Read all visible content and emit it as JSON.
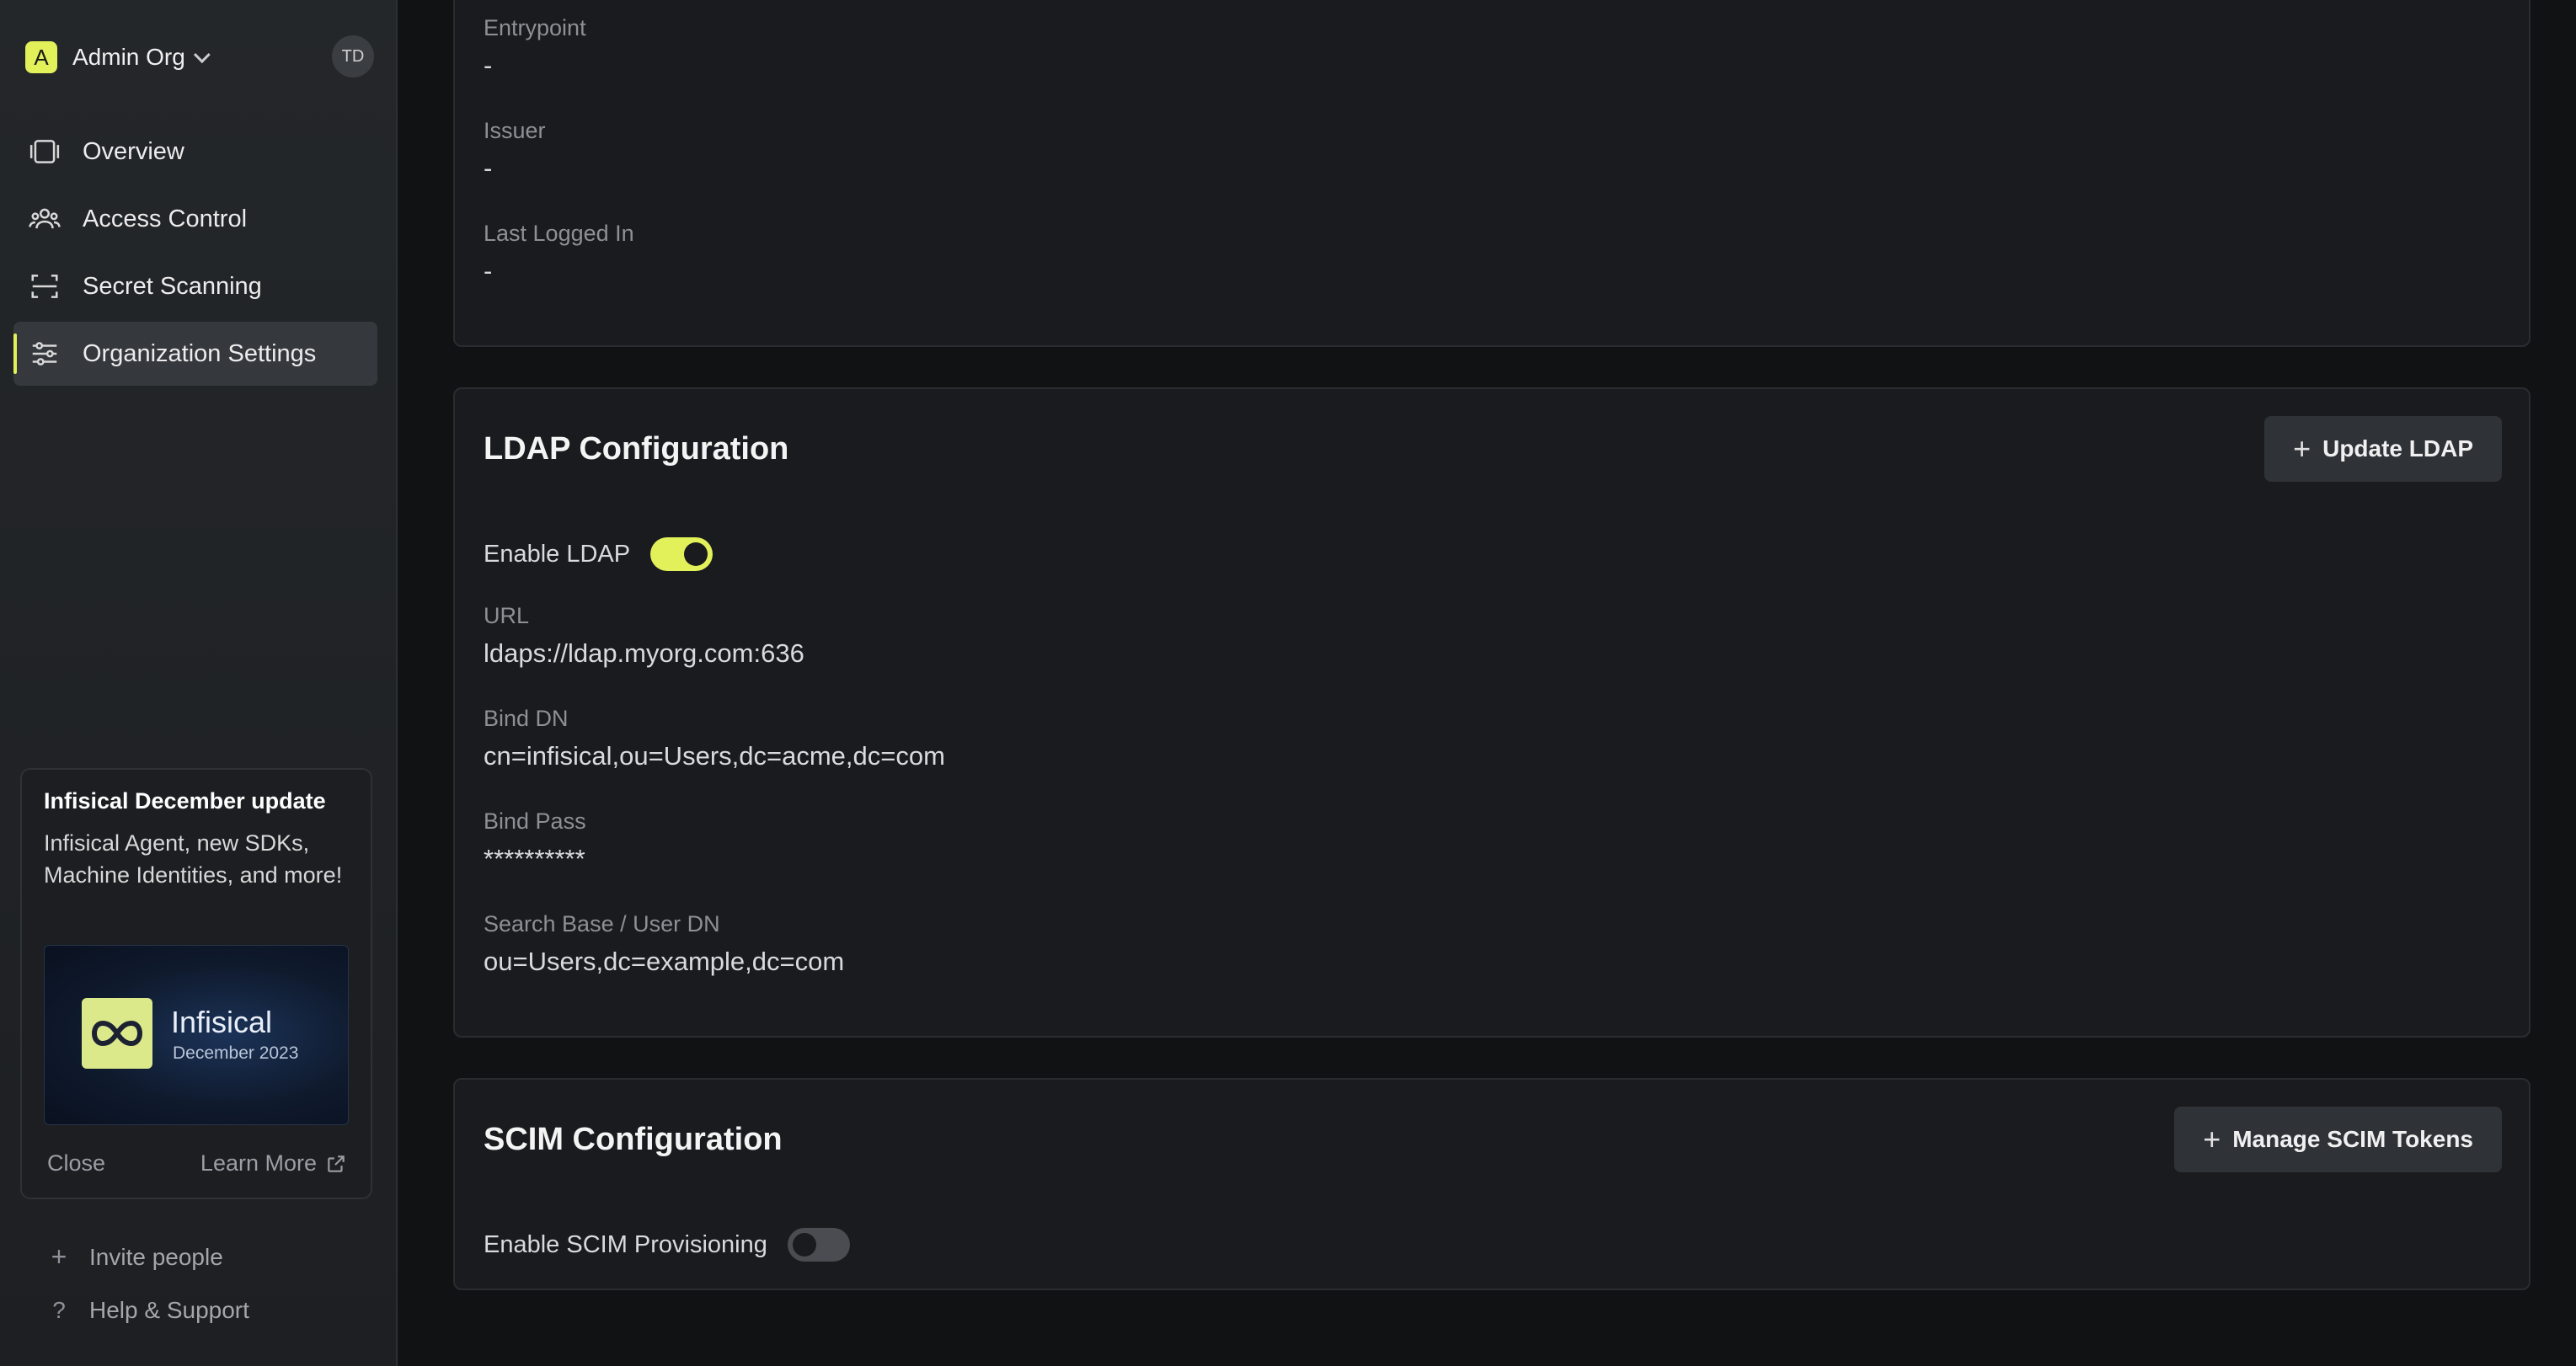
{
  "sidebar": {
    "org": {
      "badge": "A",
      "name": "Admin Org",
      "avatar": "TD"
    },
    "items": [
      {
        "label": "Overview",
        "icon": "overview-icon"
      },
      {
        "label": "Access Control",
        "icon": "users-icon"
      },
      {
        "label": "Secret Scanning",
        "icon": "scan-icon"
      },
      {
        "label": "Organization Settings",
        "icon": "sliders-icon",
        "active": true
      }
    ],
    "promo": {
      "title": "Infisical December update",
      "description": "Infisical Agent, new SDKs, Machine Identities, and more!",
      "image_brand": "Infisical",
      "image_date": "December 2023",
      "close_label": "Close",
      "learn_more_label": "Learn More"
    },
    "invite_label": "Invite people",
    "help_label": "Help & Support"
  },
  "identity_card": {
    "fields": [
      {
        "label": "Entrypoint",
        "value": "-"
      },
      {
        "label": "Issuer",
        "value": "-"
      },
      {
        "label": "Last Logged In",
        "value": "-"
      }
    ]
  },
  "ldap": {
    "title": "LDAP Configuration",
    "button_label": "Update LDAP",
    "toggle_label": "Enable LDAP",
    "toggle_on": true,
    "fields": [
      {
        "label": "URL",
        "value": "ldaps://ldap.myorg.com:636"
      },
      {
        "label": "Bind DN",
        "value": "cn=infisical,ou=Users,dc=acme,dc=com"
      },
      {
        "label": "Bind Pass",
        "value": "**********"
      },
      {
        "label": "Search Base / User DN",
        "value": "ou=Users,dc=example,dc=com"
      }
    ]
  },
  "scim": {
    "title": "SCIM Configuration",
    "button_label": "Manage SCIM Tokens",
    "toggle_label": "Enable SCIM Provisioning",
    "toggle_on": false
  },
  "colors": {
    "accent": "#e2f05a",
    "background": "#111214",
    "card": "#1a1b1e"
  }
}
